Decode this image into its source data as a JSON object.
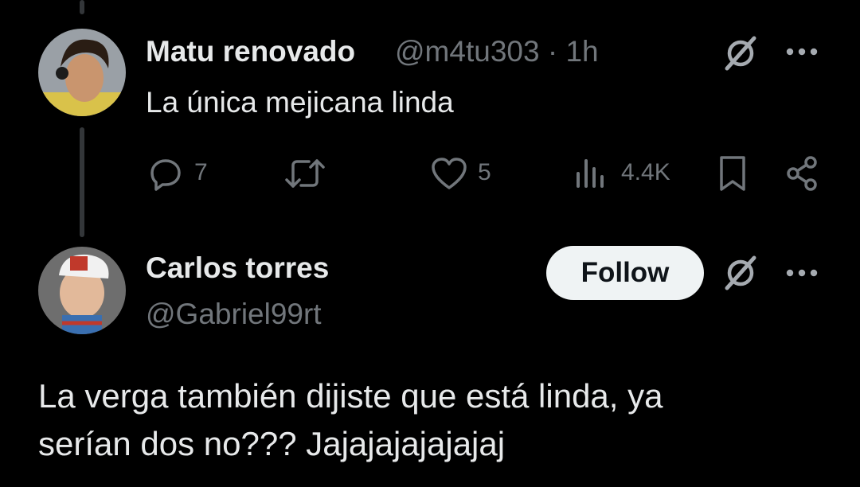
{
  "tweet": {
    "author_name": "Matu renovado",
    "handle": "@m4tu303",
    "separator": "·",
    "time": "1h",
    "text": "La única mejicana linda",
    "replies": "7",
    "likes": "5",
    "views": "4.4K"
  },
  "reply": {
    "author_name": "Carlos torres",
    "handle": "@Gabriel99rt",
    "follow_label": "Follow",
    "text_line1": "La verga también dijiste que está linda, ya",
    "text_line2": "serían dos no??? Jajajajajajajaj"
  },
  "icons": {
    "grok": "grok-icon",
    "more": "more-icon",
    "reply": "reply-icon",
    "retweet": "retweet-icon",
    "like": "like-icon",
    "views": "views-icon",
    "bookmark": "bookmark-icon",
    "share": "share-icon"
  },
  "colors": {
    "background": "#000000",
    "primary_text": "#e7e9ea",
    "secondary_text": "#71767b",
    "follow_bg": "#eff3f4"
  }
}
